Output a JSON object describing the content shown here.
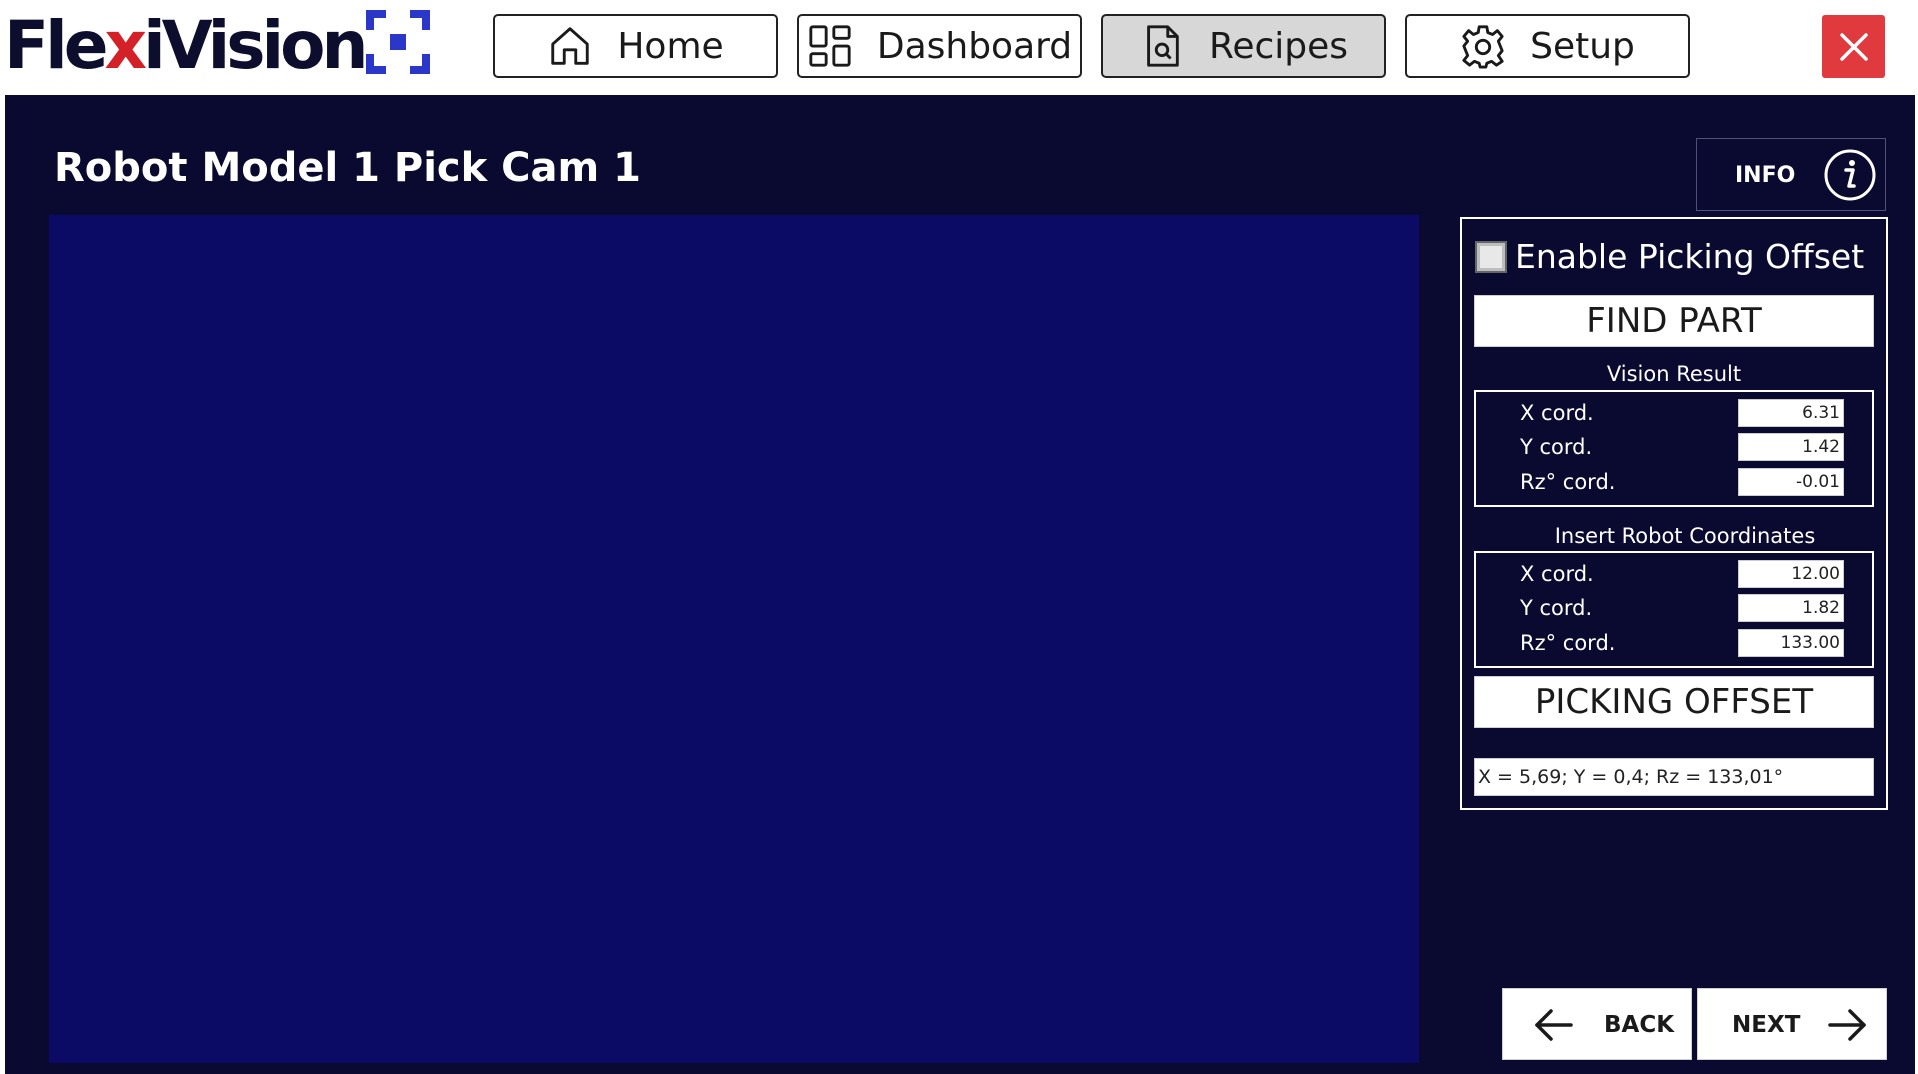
{
  "app": {
    "logo_prefix": "Fle",
    "logo_x": "x",
    "logo_suffix": "iVision",
    "accent_color": "#2b37c8",
    "logo_x_color": "#d42027"
  },
  "nav": {
    "home": {
      "label": "Home",
      "icon": "home-icon"
    },
    "dashboard": {
      "label": "Dashboard",
      "icon": "dashboard-icon"
    },
    "recipes": {
      "label": "Recipes",
      "icon": "recipe-file-icon",
      "active": true
    },
    "setup": {
      "label": "Setup",
      "icon": "gear-icon"
    },
    "close": {
      "icon": "close-icon",
      "color": "#e0393e"
    }
  },
  "page": {
    "title": "Robot Model 1 Pick Cam 1",
    "background": "#0a0a30",
    "camera_view_color": "#0b0b65"
  },
  "info_button": {
    "label": "INFO",
    "icon": "info-icon"
  },
  "panel": {
    "enable_offset_label": "Enable Picking Offset",
    "enable_offset_checked": false,
    "find_part_label": "FIND PART",
    "vision_result": {
      "title": "Vision Result",
      "rows": [
        {
          "label": "X cord.",
          "value": "6.31"
        },
        {
          "label": "Y cord.",
          "value": "1.42"
        },
        {
          "label": "Rz° cord.",
          "value": "-0.01"
        }
      ]
    },
    "robot_coords": {
      "title": "Insert Robot Coordinates",
      "rows": [
        {
          "label": "X cord.",
          "value": "12.00"
        },
        {
          "label": "Y cord.",
          "value": "1.82"
        },
        {
          "label": "Rz° cord.",
          "value": "133.00"
        }
      ]
    },
    "picking_offset_label": "PICKING OFFSET",
    "offset_result": "X = 5,69; Y = 0,4; Rz = 133,01°"
  },
  "footer": {
    "back_label": "BACK",
    "next_label": "NEXT"
  }
}
